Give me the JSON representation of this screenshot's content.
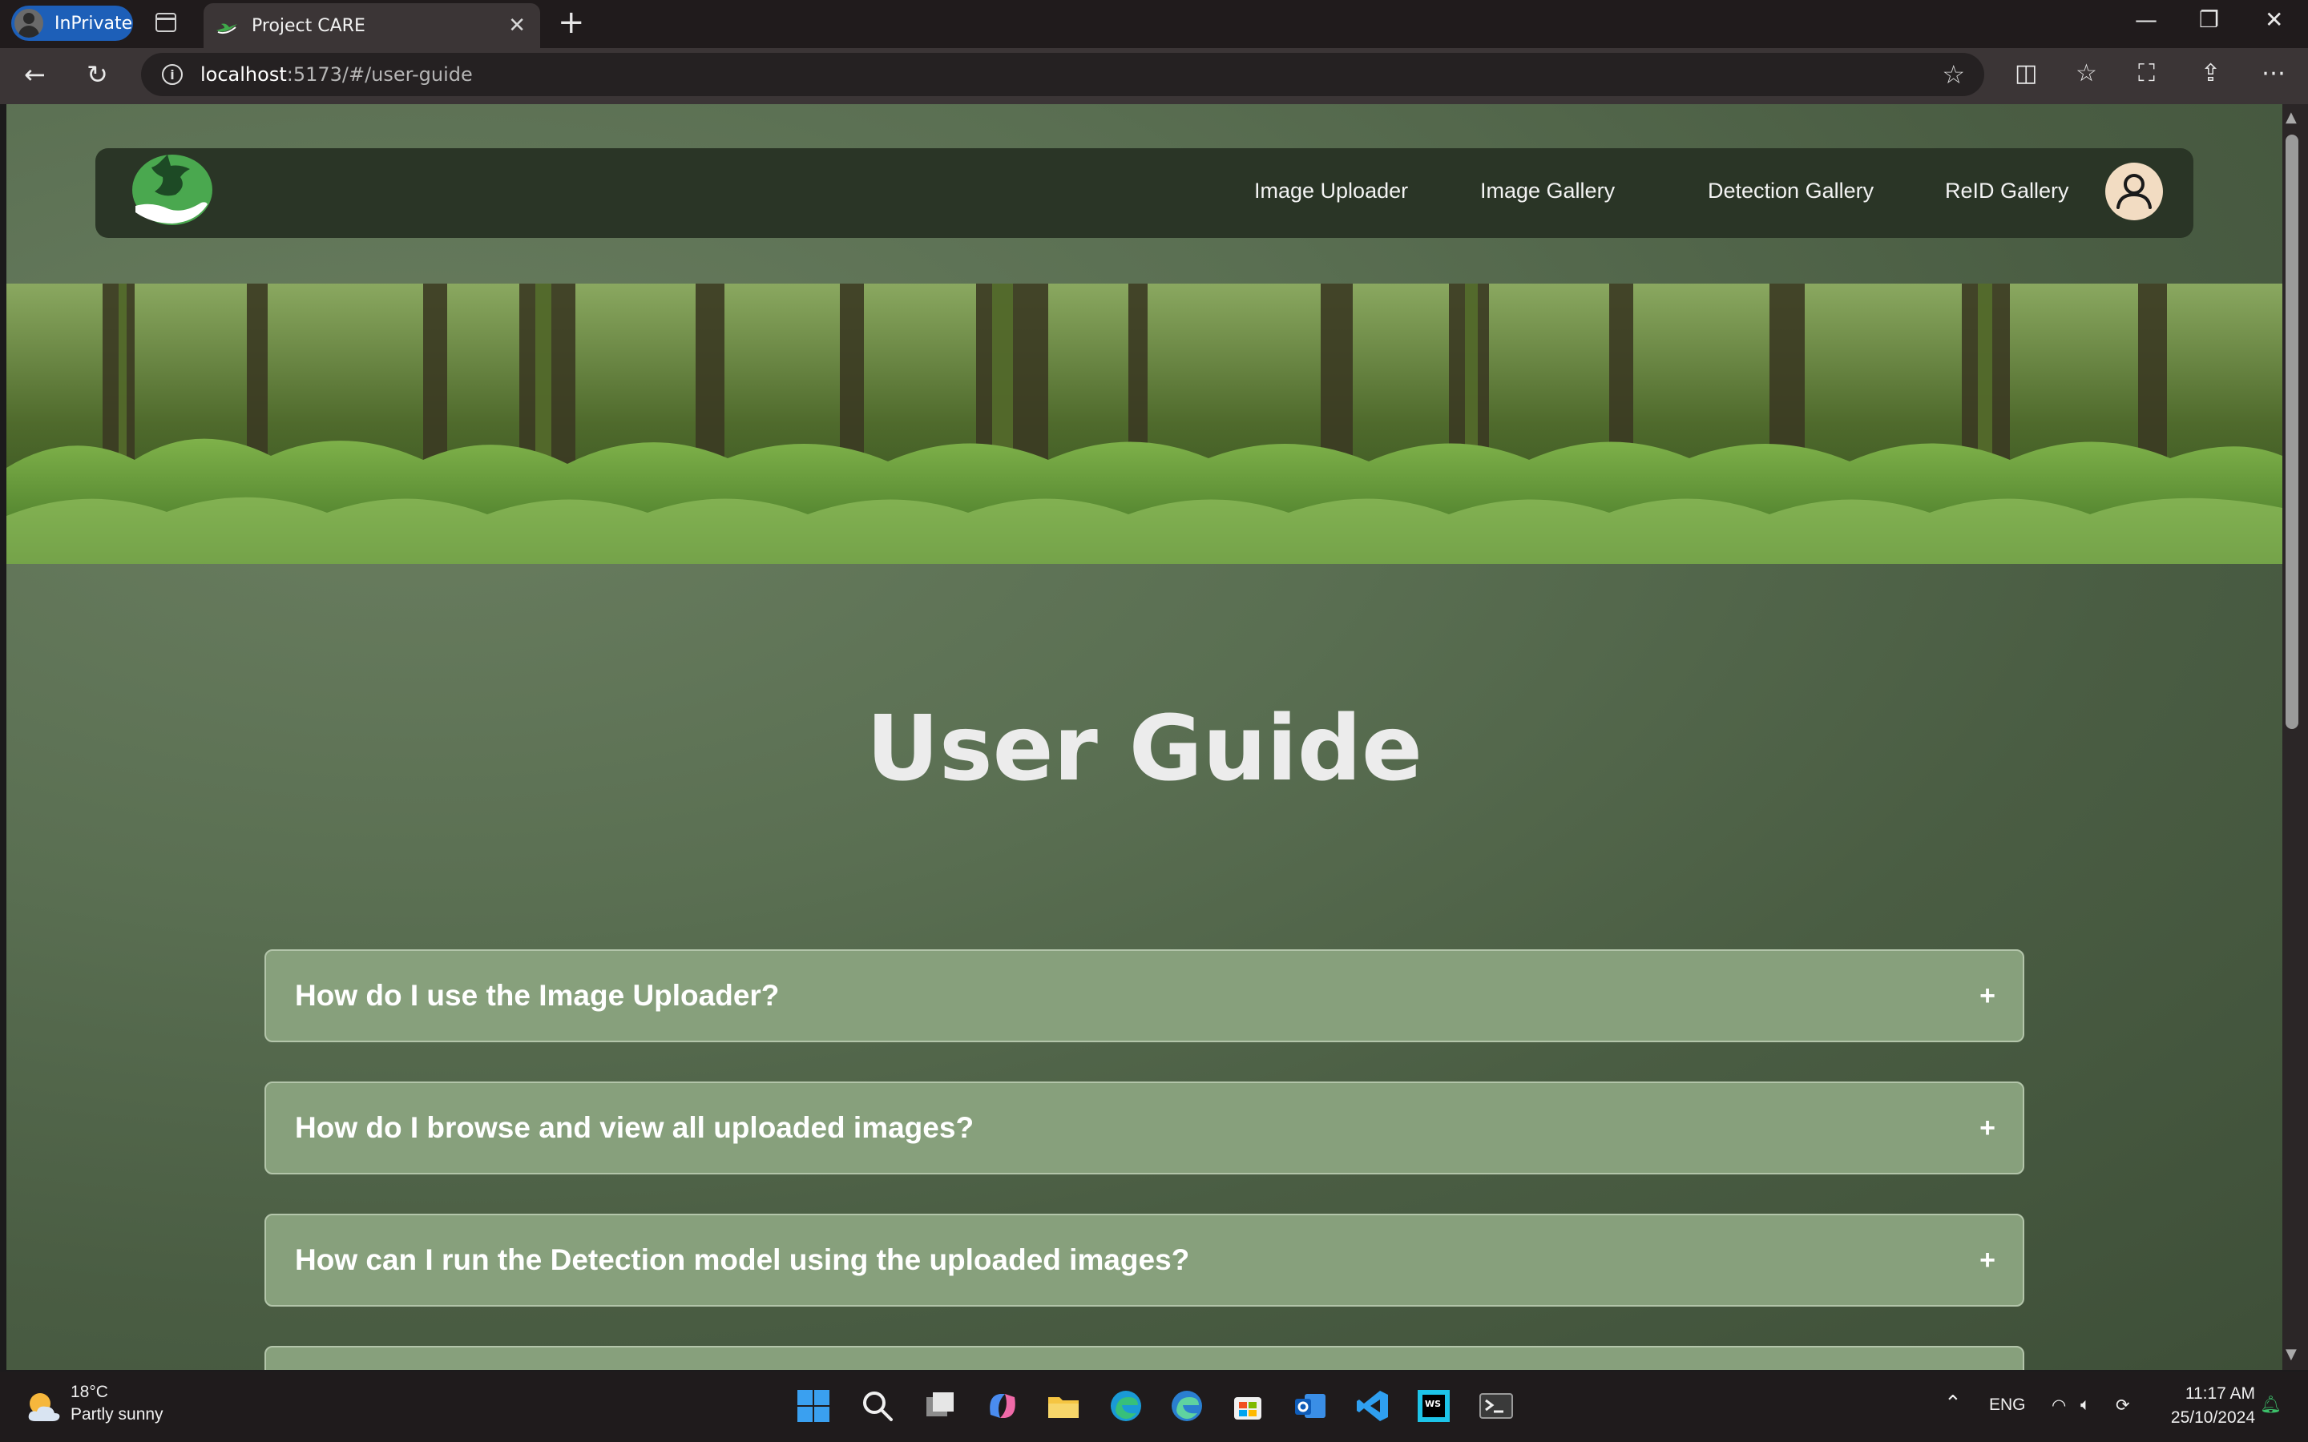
{
  "browser": {
    "inprivate_label": "InPrivate",
    "tab_title": "Project CARE",
    "url_host": "localhost",
    "url_path": ":5173/#/user-guide"
  },
  "site": {
    "nav_links": [
      "Image Uploader",
      "Image Gallery",
      "Detection Gallery",
      "ReID Gallery"
    ],
    "page_title": "User Guide",
    "faq": [
      "How do I use the Image Uploader?",
      "How do I browse and view all uploaded images?",
      "How can I run the Detection model using the uploaded images?"
    ],
    "faq_toggle": "+"
  },
  "taskbar": {
    "weather_temp": "18°C",
    "weather_condition": "Partly sunny",
    "language": "ENG",
    "time": "11:17 AM",
    "date": "25/10/2024"
  },
  "colors": {
    "page_bg": "#56694e",
    "nav_bg": "#2a3526",
    "faq_bg": "#87a07c",
    "avatar_bg": "#f2dcc2",
    "inprivate_badge": "#1d5fb8"
  }
}
